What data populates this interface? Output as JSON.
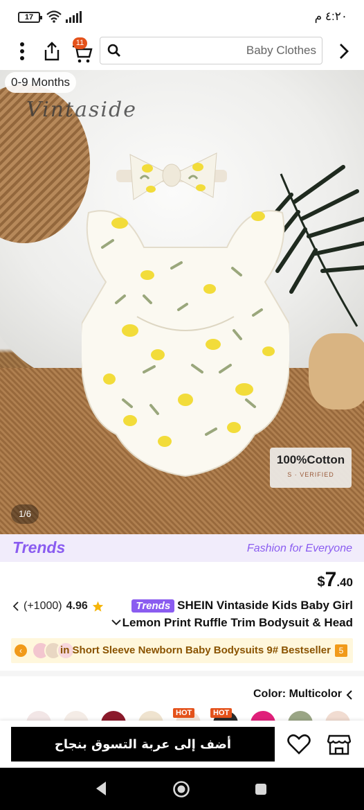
{
  "status_bar": {
    "battery": "17",
    "time": "٤:٢٠ م"
  },
  "header": {
    "cart_count": "11",
    "search_placeholder": "Baby Clothes"
  },
  "gallery": {
    "age_chip": "0-9 Months",
    "brand_watermark": "Vintaside",
    "cotton_badge": "100%Cotton",
    "cotton_badge_sub": "S · VERIFIED",
    "counter": "1/6"
  },
  "trends_banner": {
    "logo": "Trends",
    "tagline": "Fashion for Everyone"
  },
  "product": {
    "price_currency": "$",
    "price_int": "7",
    "price_dec": ".40",
    "rating": "4.96",
    "review_count": "(+1000)",
    "title_line1": "SHEIN Vintaside Kids Baby Girl",
    "trends_tag": "Trends",
    "title_line2": "Lemon Print Ruffle Trim Bodysuit & Head",
    "bestseller": "in Short Sleeve Newborn Baby Bodysuits 9# Bestseller",
    "color_label": "Color:",
    "color_value": "Multicolor"
  },
  "swatches": {
    "hot_label_1": "HOT",
    "hot_label_2": "HOT"
  },
  "actions": {
    "add_to_cart": "أضف إلى عربة التسوق بنجاح"
  },
  "colors": {
    "accent_orange": "#e4521b",
    "trends_purple": "#8a5cf0",
    "bestseller_bg": "#fff7dc"
  }
}
